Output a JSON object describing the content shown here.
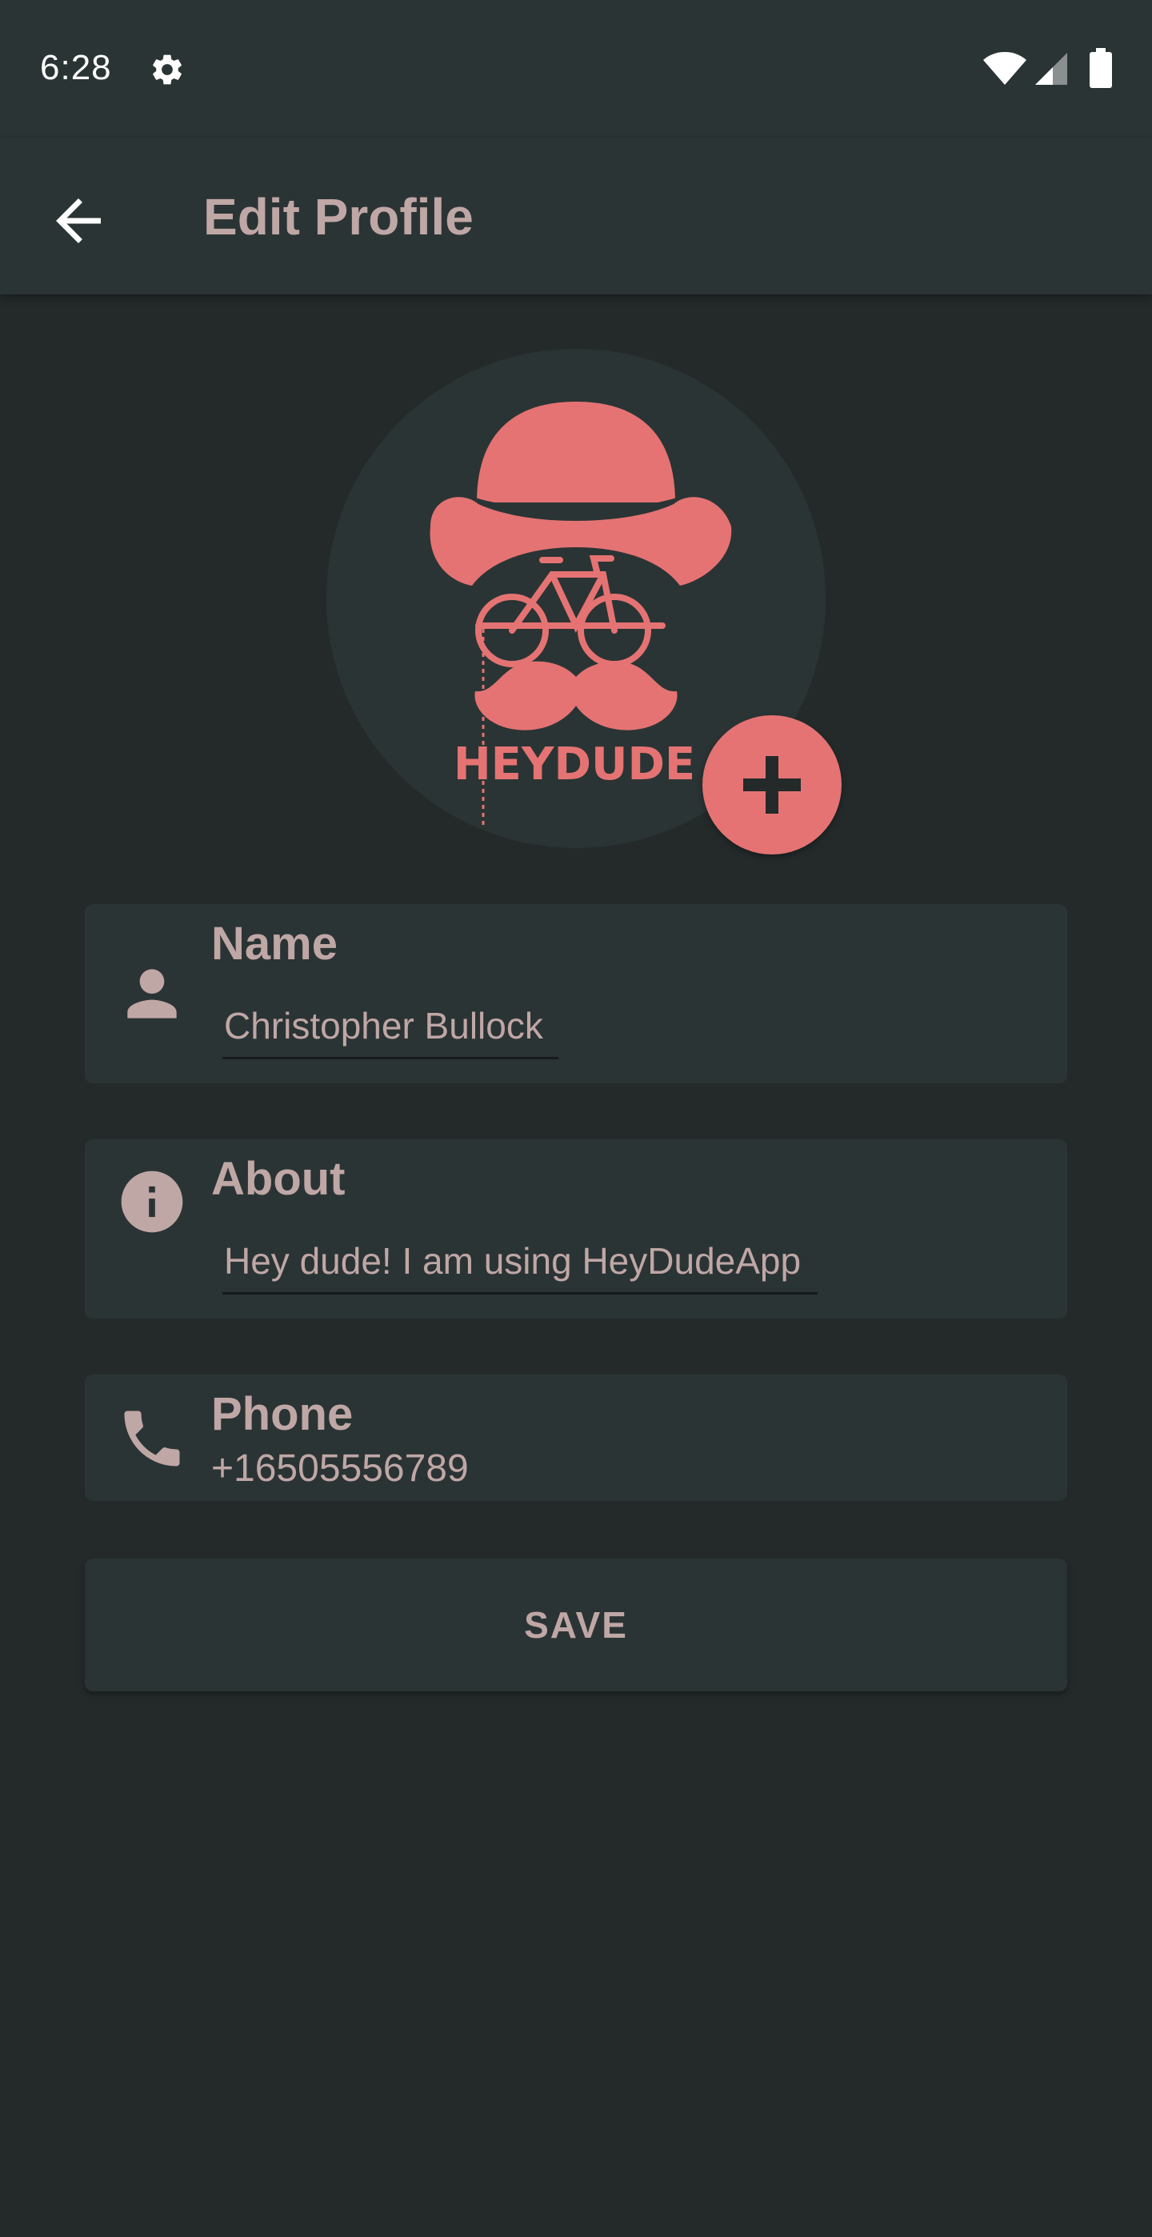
{
  "status_bar": {
    "time": "6:28",
    "icons": [
      "gear-icon",
      "wifi-icon",
      "signal-icon",
      "battery-icon"
    ]
  },
  "app_bar": {
    "title": "Edit Profile",
    "back_icon": "arrow-back-icon"
  },
  "avatar": {
    "logo_text": "HEYDUDE",
    "add_icon": "plus-icon"
  },
  "fields": {
    "name": {
      "label": "Name",
      "value": "Christopher Bullock",
      "icon": "person-icon"
    },
    "about": {
      "label": "About",
      "value": "Hey dude! I am using HeyDudeApp",
      "icon": "info-icon"
    },
    "phone": {
      "label": "Phone",
      "value": "+16505556789",
      "icon": "phone-icon"
    }
  },
  "save_label": "SAVE",
  "colors": {
    "background": "#242a2a",
    "surface": "#2b3434",
    "text": "#bfa7a6",
    "accent": "#e57373"
  }
}
